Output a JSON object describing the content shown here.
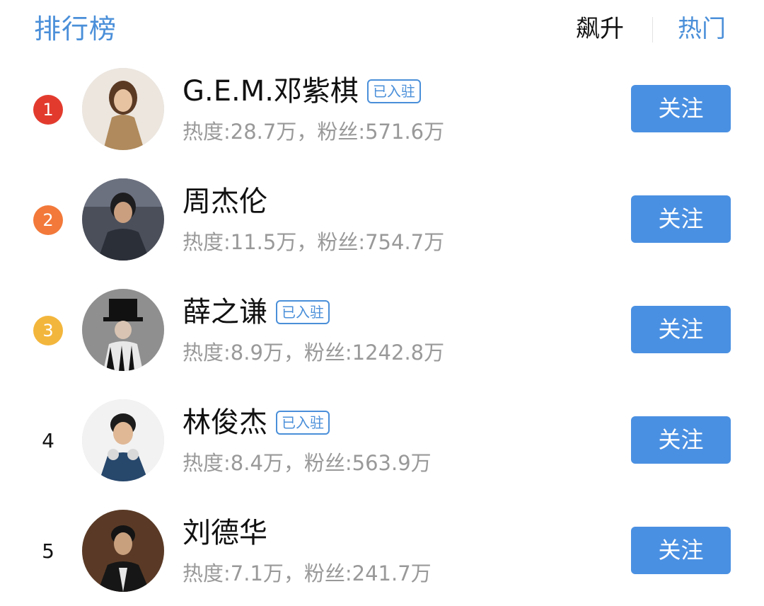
{
  "header": {
    "title": "排行榜",
    "tabs": [
      {
        "label": "飙升",
        "active": false
      },
      {
        "label": "热门",
        "active": true
      }
    ]
  },
  "colors": {
    "accent": "#4a8fd9",
    "button": "#4a90e2",
    "rank1": "#e23b2e",
    "rank2": "#f2793a",
    "rank3": "#f3b63c",
    "secondary_text": "#999999"
  },
  "list": [
    {
      "rank": "1",
      "name": "G.E.M.邓紫棋",
      "badge": "已入驻",
      "stats": "热度:28.7万，粉丝:571.6万",
      "button": "关注"
    },
    {
      "rank": "2",
      "name": "周杰伦",
      "badge": "",
      "stats": "热度:11.5万，粉丝:754.7万",
      "button": "关注"
    },
    {
      "rank": "3",
      "name": "薛之谦",
      "badge": "已入驻",
      "stats": "热度:8.9万，粉丝:1242.8万",
      "button": "关注"
    },
    {
      "rank": "4",
      "name": "林俊杰",
      "badge": "已入驻",
      "stats": "热度:8.4万，粉丝:563.9万",
      "button": "关注"
    },
    {
      "rank": "5",
      "name": "刘德华",
      "badge": "",
      "stats": "热度:7.1万，粉丝:241.7万",
      "button": "关注"
    }
  ]
}
